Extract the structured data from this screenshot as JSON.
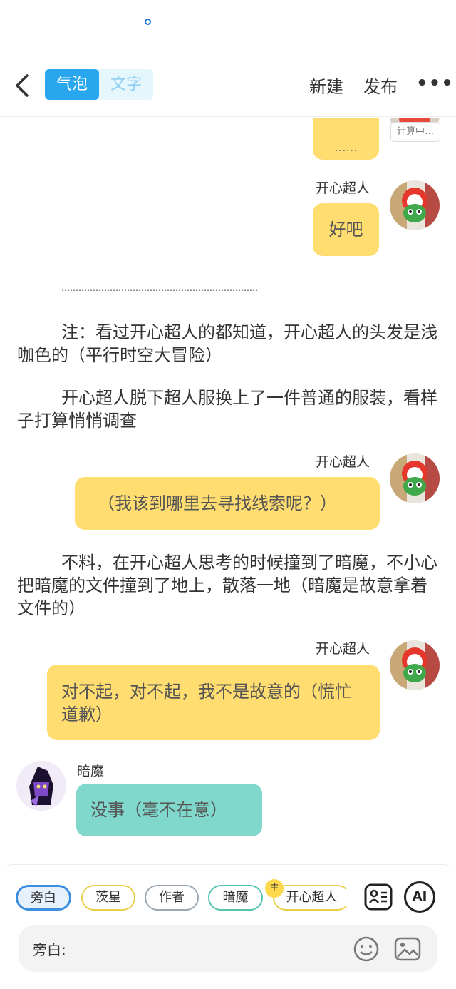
{
  "topbar": {
    "mode_bubble": "气泡",
    "mode_text": "文字",
    "new_label": "新建",
    "publish_label": "发布",
    "more_label": "•••"
  },
  "messages": {
    "partial_bubble": "……",
    "calc_badge": "计算中…",
    "msg1_speaker": "开心超人",
    "msg1_text": "好吧",
    "separator": "……………………………………………………………",
    "narr1": "注：看过开心超人的都知道，开心超人的头发是浅咖色的（平行时空大冒险）",
    "narr2": "开心超人脱下超人服换上了一件普通的服装，看样子打算悄悄调查",
    "msg2_speaker": "开心超人",
    "msg2_text": "（我该到哪里去寻找线索呢？）",
    "narr3": "不料，在开心超人思考的时候撞到了暗魔，不小心把暗魔的文件撞到了地上，散落一地（暗魔是故意拿着文件的）",
    "msg3_speaker": "开心超人",
    "msg3_text": "对不起，对不起，我不是故意的（慌忙道歉）",
    "msg4_speaker": "暗魔",
    "msg4_text": "没事（毫不在意）"
  },
  "composer": {
    "chips": [
      "旁白",
      "茨星",
      "作者",
      "暗魔",
      "开心超人"
    ],
    "master_badge": "主",
    "input_label": "旁白:",
    "ai_label": "AI"
  },
  "colors": {
    "accent": "#28a7ee",
    "bubble_yellow": "#ffdd70",
    "bubble_teal": "#7fd8cb"
  }
}
